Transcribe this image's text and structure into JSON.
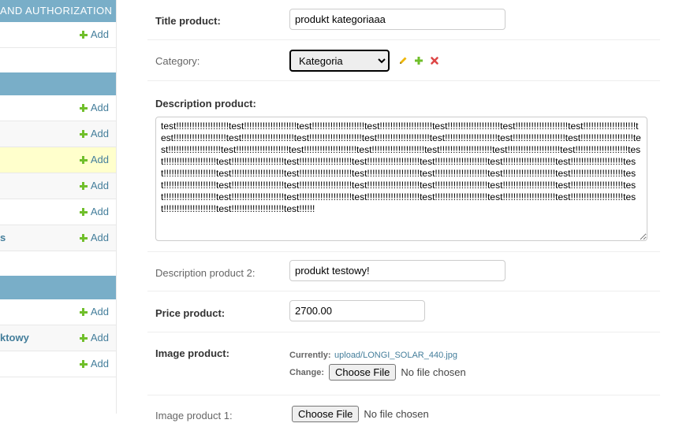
{
  "sidebar": {
    "section1_header": "AND AUTHORIZATION",
    "section1_rows": [
      {
        "label": "",
        "add": "Add"
      }
    ],
    "section2_rows": [
      {
        "label": "",
        "add": "Add"
      },
      {
        "label": "",
        "add": "Add"
      },
      {
        "label": "",
        "add": "Add"
      },
      {
        "label": "",
        "add": "Add"
      },
      {
        "label": "",
        "add": "Add"
      },
      {
        "label": "s",
        "add": "Add"
      }
    ],
    "section3_rows": [
      {
        "label": "",
        "add": "Add"
      },
      {
        "label": "ktowy",
        "add": "Add"
      },
      {
        "label": "",
        "add": "Add"
      }
    ]
  },
  "form": {
    "title_label": "Title product:",
    "title_value": "produkt kategoriaaa",
    "category_label": "Category:",
    "category_options": [
      "Kategoria"
    ],
    "category_selected": "Kategoria",
    "description_label": "Description product:",
    "description_value": "test!!!!!!!!!!!!!!!!!!!!test!!!!!!!!!!!!!!!!!!!!test!!!!!!!!!!!!!!!!!!!!test!!!!!!!!!!!!!!!!!!!!test!!!!!!!!!!!!!!!!!!!!test!!!!!!!!!!!!!!!!!!!!test!!!!!!!!!!!!!!!!!!!!test!!!!!!!!!!!!!!!!!!!!test!!!!!!!!!!!!!!!!!!!!test!!!!!!!!!!!!!!!!!!!!test!!!!!!!!!!!!!!!!!!!!test!!!!!!!!!!!!!!!!!!!!test!!!!!!!!!!!!!!!!!!!!test!!!!!!!!!!!!!!!!!!!!test!!!!!!!!!!!!!!!!!!!!test!!!!!!!!!!!!!!!!!!!!test!!!!!!!!!!!!!!!!!!!!test!!!!!!!!!!!!!!!!!!!!test!!!!!!!!!!!!!!!!!!!!test!!!!!!!!!!!!!!!!!!!!test!!!!!!!!!!!!!!!!!!!!test!!!!!!!!!!!!!!!!!!!!test!!!!!!!!!!!!!!!!!!!!test!!!!!!!!!!!!!!!!!!!!test!!!!!!!!!!!!!!!!!!!!test!!!!!!!!!!!!!!!!!!!!test!!!!!!!!!!!!!!!!!!!!test!!!!!!!!!!!!!!!!!!!!test!!!!!!!!!!!!!!!!!!!!test!!!!!!!!!!!!!!!!!!!!test!!!!!!!!!!!!!!!!!!!!test!!!!!!!!!!!!!!!!!!!!test!!!!!!!!!!!!!!!!!!!!test!!!!!!!!!!!!!!!!!!!!test!!!!!!!!!!!!!!!!!!!!test!!!!!!!!!!!!!!!!!!!!test!!!!!!!!!!!!!!!!!!!!test!!!!!!!!!!!!!!!!!!!!test!!!!!!!!!!!!!!!!!!!!test!!!!!!!!!!!!!!!!!!!!test!!!!!!!!!!!!!!!!!!!!test!!!!!!!!!!!!!!!!!!!!test!!!!!!!!!!!!!!!!!!!!test!!!!!!!!!!!!!!!!!!!!test!!!!!!!!!!!!!!!!!!!!test!!!!!!!!!!!!!!!!!!!!test!!!!!!!!!!!!!!!!!!!!test!!!!!!!!!!!!!!!!!!!!test!!!!!!!!!!!!!!!!!!!!test!!!!!!!!!!!!!!!!!!!!test!!!!!!!!!!!!!!!!!!!!test!!!!!!",
    "description2_label": "Description product 2:",
    "description2_value": "produkt testowy!",
    "price_label": "Price product:",
    "price_value": "2700.00",
    "image_label": "Image product:",
    "image_currently_label": "Currently:",
    "image_currently_value": "upload/LONGI_SOLAR_440.jpg",
    "image_change_label": "Change:",
    "choose_file_label": "Choose File",
    "no_file_label": "No file chosen",
    "next_label_partial": "Image product 1:",
    "next_choose_file_label": "Choose File",
    "next_no_file_label": "No file chosen"
  },
  "colors": {
    "sidebar_header": "#79aec8",
    "link": "#447e9b",
    "add_plus": "#70bf2b",
    "highlight_row": "#ffffcc"
  }
}
